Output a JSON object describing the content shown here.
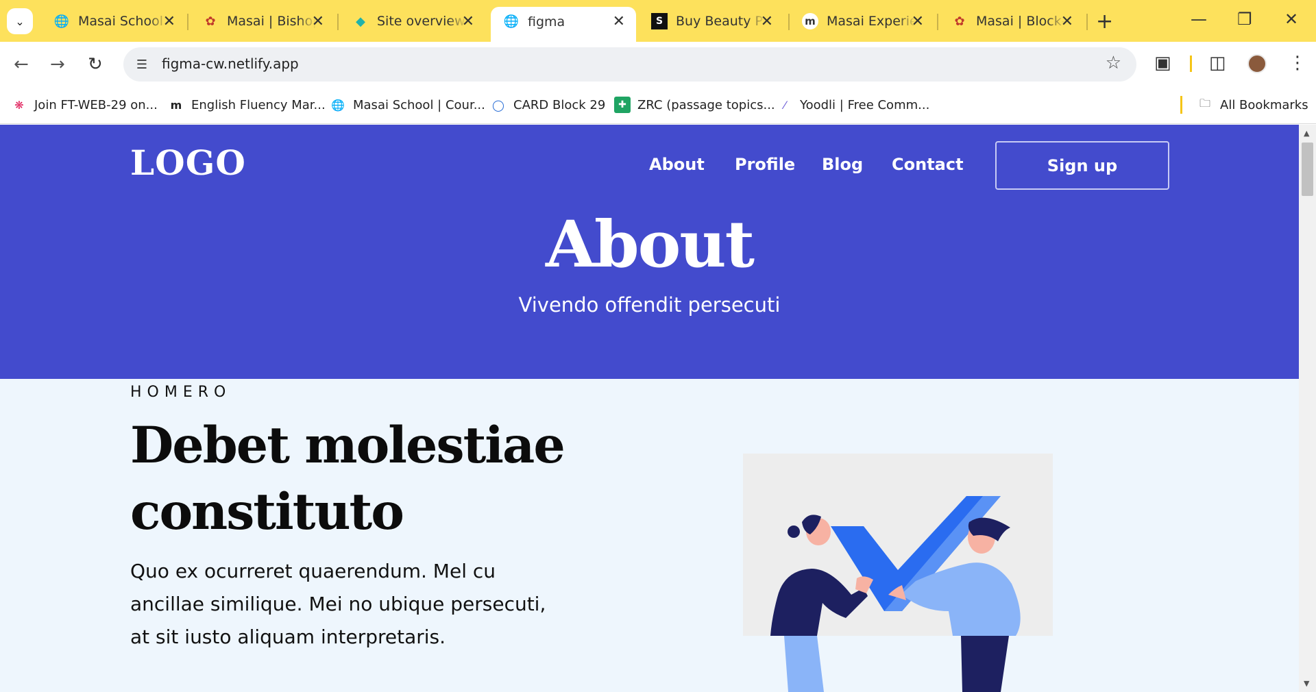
{
  "browser": {
    "tabs": [
      {
        "title": "Masai School",
        "icon": "globe-icon"
      },
      {
        "title": "Masai | Bishop",
        "icon": "masai-flower-icon"
      },
      {
        "title": "Site overview |",
        "icon": "netlify-diamond-icon"
      },
      {
        "title": "figma",
        "icon": "globe-icon",
        "active": true
      },
      {
        "title": "Buy Beauty Pr",
        "icon": "beauty-logo-icon"
      },
      {
        "title": "Masai Experie",
        "icon": "masai-m-icon"
      },
      {
        "title": "Masai | Block-",
        "icon": "masai-flower-icon"
      }
    ],
    "address": {
      "url": "figma-cw.netlify.app"
    },
    "bookmarks": [
      {
        "label": "Join FT-WEB-29 on...",
        "icon": "slack-icon"
      },
      {
        "label": "English Fluency Mar...",
        "icon": "masai-m-icon"
      },
      {
        "label": "Masai School | Cour...",
        "icon": "globe-icon"
      },
      {
        "label": "CARD Block 29",
        "icon": "card-icon"
      },
      {
        "label": "ZRC (passage topics...",
        "icon": "sheets-icon"
      },
      {
        "label": "Yoodli | Free Comm...",
        "icon": "yoodli-icon"
      }
    ],
    "all_bookmarks": "All Bookmarks"
  },
  "site": {
    "logo": "LOGO",
    "nav": [
      "About",
      "Profile",
      "Blog",
      "Contact"
    ],
    "signup": "Sign up",
    "hero": {
      "title": "About",
      "subtitle": "Vivendo offendit persecuti"
    },
    "section": {
      "eyebrow": "HOMERO",
      "headline": "Debet molestiae constituto",
      "body": "Quo ex ocurreret quaerendum. Mel cu ancillae similique. Mei no ubique persecuti, at sit iusto aliquam interpretaris."
    }
  },
  "colors": {
    "hero_bg": "#434bcd",
    "section_bg": "#eef6fd",
    "tab_strip": "#fde15c"
  }
}
